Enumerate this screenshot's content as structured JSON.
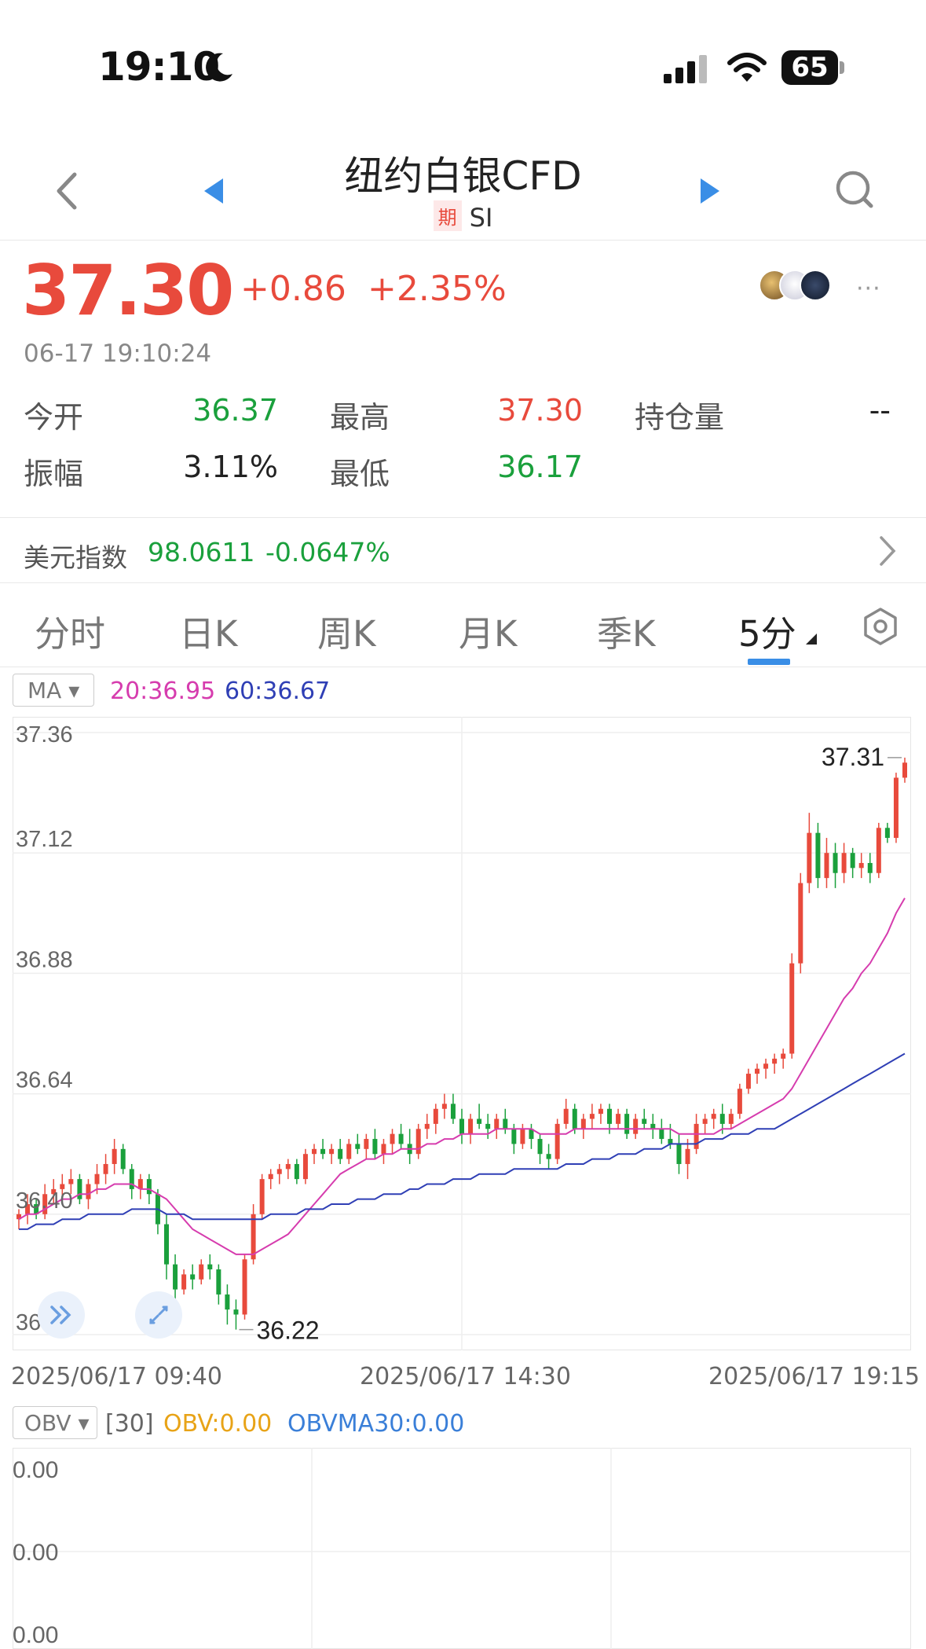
{
  "status_bar": {
    "time": "19:10",
    "battery": "65",
    "icons": [
      "moon-icon",
      "signal-icon",
      "wifi-icon",
      "battery-icon"
    ]
  },
  "header": {
    "title": "纽约白银CFD",
    "tag": "期",
    "code": "SI",
    "icons": [
      "back-icon",
      "prev-triangle-icon",
      "next-triangle-icon",
      "search-icon"
    ]
  },
  "quote": {
    "price": "37.30",
    "change": "+0.86",
    "change_pct": "+2.35%",
    "time": "06-17 19:10:24",
    "more": "···"
  },
  "stats": {
    "open_label": "今开",
    "open": "36.37",
    "high_label": "最高",
    "high": "37.30",
    "oi_label": "持仓量",
    "oi": "--",
    "amp_label": "振幅",
    "amp": "3.11%",
    "low_label": "最低",
    "low": "36.17"
  },
  "usd_index": {
    "label": "美元指数",
    "value": "98.0611",
    "change": "-0.0647%"
  },
  "tabs": [
    "分时",
    "日K",
    "周K",
    "月K",
    "季K",
    "5分"
  ],
  "active_tab": "5分",
  "ma_legend": {
    "indicator": "MA",
    "ma20": "20:36.95",
    "ma60": "60:36.67"
  },
  "colors": {
    "up": "#e84a3c",
    "down": "#1aa03c",
    "ma20": "#d63cae",
    "ma60": "#2f3fb5",
    "accent": "#3a8ee6"
  },
  "chart_data": {
    "type": "candlestick",
    "interval": "5分",
    "y_ticks": [
      "37.36",
      "37.12",
      "36.88",
      "36.64",
      "36.40",
      "36.16"
    ],
    "ylim": [
      36.16,
      37.36
    ],
    "x_labels": [
      "2025/06/17 09:40",
      "2025/06/17 14:30",
      "2025/06/17 19:15"
    ],
    "max_label": "37.31",
    "min_label": "36.22",
    "grid": true,
    "candles": [
      [
        36.39,
        36.41,
        36.37,
        36.4
      ],
      [
        36.4,
        36.44,
        36.38,
        36.42
      ],
      [
        36.42,
        36.43,
        36.39,
        36.4
      ],
      [
        36.4,
        36.46,
        36.39,
        36.44
      ],
      [
        36.44,
        36.47,
        36.42,
        36.45
      ],
      [
        36.45,
        36.48,
        36.43,
        36.46
      ],
      [
        36.46,
        36.49,
        36.44,
        36.47
      ],
      [
        36.47,
        36.48,
        36.42,
        36.43
      ],
      [
        36.43,
        36.47,
        36.41,
        36.46
      ],
      [
        36.46,
        36.5,
        36.44,
        36.48
      ],
      [
        36.48,
        36.52,
        36.46,
        36.5
      ],
      [
        36.5,
        36.55,
        36.48,
        36.53
      ],
      [
        36.53,
        36.54,
        36.48,
        36.49
      ],
      [
        36.49,
        36.5,
        36.43,
        36.45
      ],
      [
        36.45,
        36.48,
        36.43,
        36.47
      ],
      [
        36.47,
        36.48,
        36.42,
        36.44
      ],
      [
        36.44,
        36.45,
        36.36,
        36.38
      ],
      [
        36.38,
        36.4,
        36.27,
        36.3
      ],
      [
        36.3,
        36.32,
        36.22,
        36.25
      ],
      [
        36.25,
        36.29,
        36.24,
        36.28
      ],
      [
        36.28,
        36.3,
        36.25,
        36.27
      ],
      [
        36.27,
        36.31,
        36.26,
        36.3
      ],
      [
        36.3,
        36.32,
        36.27,
        36.29
      ],
      [
        36.29,
        36.3,
        36.22,
        36.24
      ],
      [
        36.24,
        36.26,
        36.18,
        36.21
      ],
      [
        36.21,
        36.23,
        36.17,
        36.2
      ],
      [
        36.2,
        36.32,
        36.19,
        36.31
      ],
      [
        36.31,
        36.42,
        36.3,
        36.4
      ],
      [
        36.4,
        36.48,
        36.39,
        36.47
      ],
      [
        36.47,
        36.49,
        36.45,
        36.48
      ],
      [
        36.48,
        36.5,
        36.46,
        36.49
      ],
      [
        36.49,
        36.51,
        36.47,
        36.5
      ],
      [
        36.5,
        36.51,
        36.46,
        36.47
      ],
      [
        36.47,
        36.53,
        36.46,
        36.52
      ],
      [
        36.52,
        36.54,
        36.5,
        36.53
      ],
      [
        36.53,
        36.55,
        36.51,
        36.52
      ],
      [
        36.52,
        36.54,
        36.5,
        36.53
      ],
      [
        36.53,
        36.55,
        36.5,
        36.51
      ],
      [
        36.51,
        36.55,
        36.5,
        36.54
      ],
      [
        36.54,
        36.56,
        36.52,
        36.53
      ],
      [
        36.53,
        36.56,
        36.51,
        36.55
      ],
      [
        36.55,
        36.57,
        36.51,
        36.52
      ],
      [
        36.52,
        36.55,
        36.5,
        36.54
      ],
      [
        36.54,
        36.57,
        36.52,
        36.56
      ],
      [
        36.56,
        36.58,
        36.53,
        36.54
      ],
      [
        36.54,
        36.57,
        36.5,
        36.52
      ],
      [
        36.52,
        36.58,
        36.51,
        36.57
      ],
      [
        36.57,
        36.6,
        36.55,
        36.58
      ],
      [
        36.58,
        36.62,
        36.56,
        36.61
      ],
      [
        36.61,
        36.64,
        36.59,
        36.62
      ],
      [
        36.62,
        36.64,
        36.58,
        36.59
      ],
      [
        36.59,
        36.61,
        36.54,
        36.56
      ],
      [
        36.56,
        36.6,
        36.54,
        36.59
      ],
      [
        36.59,
        36.62,
        36.57,
        36.58
      ],
      [
        36.58,
        36.6,
        36.55,
        36.57
      ],
      [
        36.57,
        36.6,
        36.55,
        36.59
      ],
      [
        36.59,
        36.61,
        36.56,
        36.57
      ],
      [
        36.57,
        36.58,
        36.52,
        36.54
      ],
      [
        36.54,
        36.58,
        36.53,
        36.57
      ],
      [
        36.57,
        36.58,
        36.53,
        36.55
      ],
      [
        36.55,
        36.56,
        36.5,
        36.52
      ],
      [
        36.52,
        36.54,
        36.49,
        36.51
      ],
      [
        36.51,
        36.59,
        36.5,
        36.58
      ],
      [
        36.58,
        36.63,
        36.57,
        36.61
      ],
      [
        36.61,
        36.62,
        36.56,
        36.57
      ],
      [
        36.57,
        36.6,
        36.55,
        36.59
      ],
      [
        36.59,
        36.62,
        36.57,
        36.6
      ],
      [
        36.6,
        36.62,
        36.58,
        36.61
      ],
      [
        36.61,
        36.62,
        36.56,
        36.58
      ],
      [
        36.58,
        36.61,
        36.57,
        36.6
      ],
      [
        36.6,
        36.61,
        36.55,
        36.56
      ],
      [
        36.56,
        36.6,
        36.55,
        36.59
      ],
      [
        36.59,
        36.61,
        36.57,
        36.58
      ],
      [
        36.58,
        36.6,
        36.55,
        36.57
      ],
      [
        36.57,
        36.59,
        36.54,
        36.55
      ],
      [
        36.55,
        36.58,
        36.53,
        36.54
      ],
      [
        36.54,
        36.56,
        36.48,
        36.5
      ],
      [
        36.5,
        36.55,
        36.47,
        36.53
      ],
      [
        36.53,
        36.6,
        36.52,
        36.58
      ],
      [
        36.58,
        36.6,
        36.56,
        36.59
      ],
      [
        36.59,
        36.61,
        36.57,
        36.6
      ],
      [
        36.6,
        36.62,
        36.56,
        36.58
      ],
      [
        36.58,
        36.61,
        36.57,
        36.6
      ],
      [
        36.6,
        36.66,
        36.59,
        36.65
      ],
      [
        36.65,
        36.69,
        36.64,
        36.68
      ],
      [
        36.68,
        36.7,
        36.66,
        36.69
      ],
      [
        36.69,
        36.71,
        36.67,
        36.7
      ],
      [
        36.7,
        36.72,
        36.68,
        36.71
      ],
      [
        36.71,
        36.73,
        36.69,
        36.72
      ],
      [
        36.72,
        36.92,
        36.71,
        36.9
      ],
      [
        36.9,
        37.08,
        36.88,
        37.06
      ],
      [
        37.06,
        37.2,
        37.04,
        37.16
      ],
      [
        37.16,
        37.18,
        37.05,
        37.07
      ],
      [
        37.07,
        37.15,
        37.05,
        37.12
      ],
      [
        37.12,
        37.14,
        37.05,
        37.08
      ],
      [
        37.08,
        37.14,
        37.06,
        37.12
      ],
      [
        37.12,
        37.13,
        37.07,
        37.09
      ],
      [
        37.09,
        37.12,
        37.07,
        37.1
      ],
      [
        37.1,
        37.12,
        37.06,
        37.08
      ],
      [
        37.08,
        37.18,
        37.07,
        37.17
      ],
      [
        37.17,
        37.18,
        37.14,
        37.15
      ],
      [
        37.15,
        37.28,
        37.14,
        37.27
      ],
      [
        37.27,
        37.31,
        37.26,
        37.3
      ]
    ],
    "ma20": [
      36.39,
      36.4,
      36.4,
      36.41,
      36.42,
      36.43,
      36.43,
      36.44,
      36.44,
      36.45,
      36.45,
      36.46,
      36.46,
      36.46,
      36.45,
      36.45,
      36.44,
      36.43,
      36.41,
      36.39,
      36.37,
      36.36,
      36.35,
      36.34,
      36.33,
      36.32,
      36.32,
      36.32,
      36.33,
      36.34,
      36.35,
      36.36,
      36.38,
      36.4,
      36.42,
      36.44,
      36.46,
      36.48,
      36.49,
      36.5,
      36.51,
      36.51,
      36.52,
      36.52,
      36.53,
      36.53,
      36.53,
      36.54,
      36.54,
      36.55,
      36.55,
      36.56,
      36.56,
      36.56,
      36.56,
      36.57,
      36.57,
      36.57,
      36.57,
      36.57,
      36.56,
      36.56,
      36.56,
      36.56,
      36.57,
      36.57,
      36.57,
      36.57,
      36.57,
      36.57,
      36.57,
      36.57,
      36.57,
      36.57,
      36.57,
      36.57,
      36.56,
      36.56,
      36.56,
      36.56,
      36.56,
      36.57,
      36.57,
      36.58,
      36.59,
      36.6,
      36.61,
      36.62,
      36.63,
      36.65,
      36.68,
      36.71,
      36.74,
      36.77,
      36.8,
      36.83,
      36.85,
      36.88,
      36.9,
      36.93,
      36.96,
      37.0,
      37.03
    ],
    "ma60": [
      36.37,
      36.37,
      36.38,
      36.38,
      36.38,
      36.39,
      36.39,
      36.39,
      36.4,
      36.4,
      36.4,
      36.4,
      36.4,
      36.41,
      36.41,
      36.41,
      36.41,
      36.4,
      36.4,
      36.4,
      36.39,
      36.39,
      36.39,
      36.39,
      36.39,
      36.39,
      36.39,
      36.39,
      36.39,
      36.4,
      36.4,
      36.4,
      36.4,
      36.41,
      36.41,
      36.41,
      36.42,
      36.42,
      36.42,
      36.43,
      36.43,
      36.43,
      36.44,
      36.44,
      36.44,
      36.45,
      36.45,
      36.46,
      36.46,
      36.46,
      36.47,
      36.47,
      36.47,
      36.48,
      36.48,
      36.48,
      36.48,
      36.49,
      36.49,
      36.49,
      36.49,
      36.49,
      36.49,
      36.5,
      36.5,
      36.5,
      36.51,
      36.51,
      36.51,
      36.52,
      36.52,
      36.52,
      36.53,
      36.53,
      36.53,
      36.54,
      36.54,
      36.54,
      36.54,
      36.55,
      36.55,
      36.55,
      36.56,
      36.56,
      36.56,
      36.57,
      36.57,
      36.57,
      36.58,
      36.59,
      36.6,
      36.61,
      36.62,
      36.63,
      36.64,
      36.65,
      36.66,
      36.67,
      36.68,
      36.69,
      36.7,
      36.71,
      36.72
    ]
  },
  "obv": {
    "indicator": "OBV",
    "param": "[30]",
    "obv": "OBV:0.00",
    "obvma": "OBVMA30:0.00",
    "y_ticks": [
      "0.00",
      "0.00",
      "0.00"
    ]
  }
}
